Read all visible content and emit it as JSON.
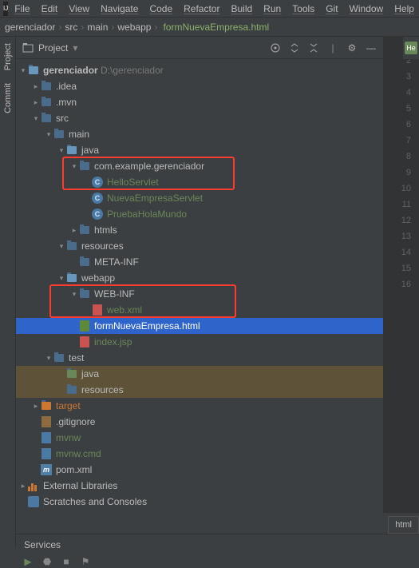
{
  "menu": [
    "File",
    "Edit",
    "View",
    "Navigate",
    "Code",
    "Refactor",
    "Build",
    "Run",
    "Tools",
    "Git",
    "Window",
    "Help"
  ],
  "breadcrumb": [
    "gerenciador",
    "src",
    "main",
    "webapp",
    "formNuevaEmpresa.html"
  ],
  "project_label": "Project",
  "tree": {
    "root": {
      "name": "gerenciador",
      "hint": "D:\\gerenciador"
    },
    "idea": ".idea",
    "mvn": ".mvn",
    "src": "src",
    "main": "main",
    "java": "java",
    "pkg": "com.example.gerenciador",
    "hello": "HelloServlet",
    "nueva": "NuevaEmpresaServlet",
    "prueba": "PruebaHolaMundo",
    "htmls": "htmls",
    "resources": "resources",
    "metainf": "META-INF",
    "webapp": "webapp",
    "webinf": "WEB-INF",
    "webxml": "web.xml",
    "form": "formNuevaEmpresa.html",
    "index": "index.jsp",
    "test": "test",
    "tjava": "java",
    "tres": "resources",
    "target": "target",
    "gitignore": ".gitignore",
    "mvnw": "mvnw",
    "mvnwcmd": "mvnw.cmd",
    "pom": "pom.xml",
    "extlib": "External Libraries",
    "scratch": "Scratches and Consoles"
  },
  "gutter_lines": 16,
  "right_badge": "He",
  "bottom_tab": "html",
  "services": "Services",
  "sidetabs": {
    "project": "Project",
    "commit": "Commit"
  }
}
